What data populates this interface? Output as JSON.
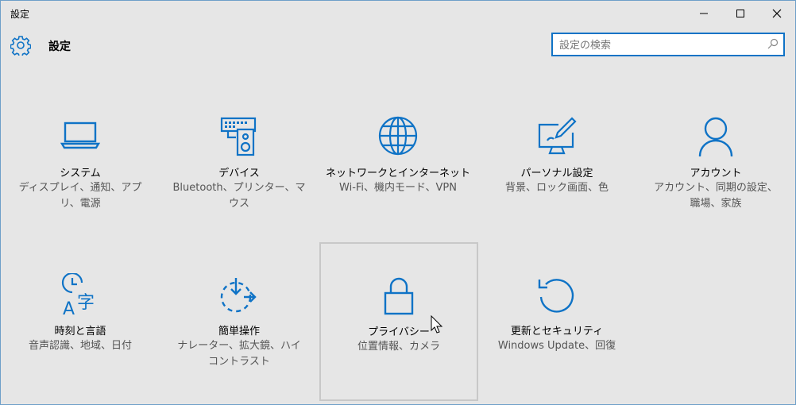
{
  "window": {
    "title": "設定"
  },
  "header": {
    "title": "設定",
    "search_placeholder": "設定の検索"
  },
  "tiles": [
    {
      "id": "system",
      "title": "システム",
      "desc": "ディスプレイ、通知、アプリ、電源",
      "icon": "laptop-icon"
    },
    {
      "id": "devices",
      "title": "デバイス",
      "desc": "Bluetooth、プリンター、マウス",
      "icon": "devices-icon"
    },
    {
      "id": "network",
      "title": "ネットワークとインターネット",
      "desc": "Wi-Fi、機内モード、VPN",
      "icon": "globe-icon"
    },
    {
      "id": "personalization",
      "title": "パーソナル設定",
      "desc": "背景、ロック画面、色",
      "icon": "paint-monitor-icon"
    },
    {
      "id": "accounts",
      "title": "アカウント",
      "desc": "アカウント、同期の設定、職場、家族",
      "icon": "person-icon"
    },
    {
      "id": "time-language",
      "title": "時刻と言語",
      "desc": "音声認識、地域、日付",
      "icon": "clock-language-icon"
    },
    {
      "id": "ease-of-access",
      "title": "簡単操作",
      "desc": "ナレーター、拡大鏡、ハイコントラスト",
      "icon": "ease-of-access-icon"
    },
    {
      "id": "privacy",
      "title": "プライバシー",
      "desc": "位置情報、カメラ",
      "icon": "lock-icon"
    },
    {
      "id": "update-security",
      "title": "更新とセキュリティ",
      "desc": "Windows Update、回復",
      "icon": "refresh-icon"
    }
  ],
  "colors": {
    "accent": "#0f73c6",
    "background": "#e6e6e6",
    "hover_border": "#c8c8c8"
  }
}
